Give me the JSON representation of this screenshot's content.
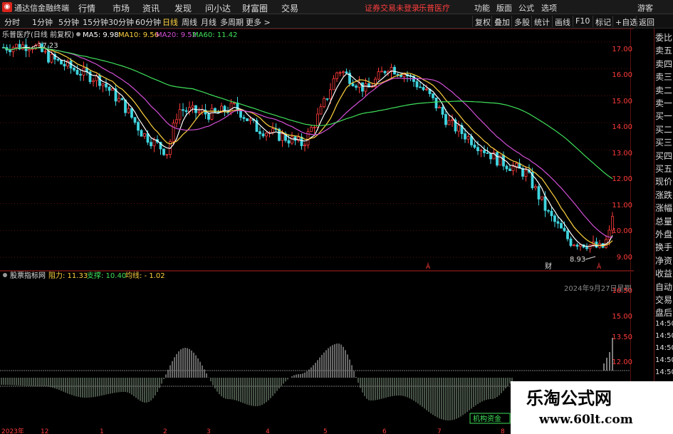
{
  "titlebar": {
    "app_title": "通达信金融终端",
    "menus": [
      "行情",
      "市场",
      "资讯",
      "发现",
      "问小达",
      "财富圈",
      "交易"
    ],
    "alert": "证券交易未登录",
    "stock_name": "乐普医疗",
    "right_menus": [
      "功能",
      "版面",
      "公式",
      "选项"
    ],
    "user": "游客"
  },
  "periods": [
    "分时",
    "1分钟",
    "5分钟",
    "15分钟",
    "30分钟",
    "60分钟",
    "日线",
    "周线",
    "月线",
    "多周期",
    "更多 >"
  ],
  "active_period": "日线",
  "toolbar": [
    "复权",
    "叠加",
    "多股",
    "统计",
    "画线",
    "F10",
    "标记",
    "+自选",
    "返回"
  ],
  "main_legend": {
    "title": "乐普医疗(日线 前复权)",
    "ma5": "MA5: 9.98",
    "ma10": "MA10: 9.56",
    "ma20": "MA20: 9.52",
    "ma60": "MA60: 11.42"
  },
  "price_ticks": [
    "17.00",
    "16.00",
    "15.00",
    "14.00",
    "13.00",
    "12.00",
    "11.00",
    "10.00",
    "9.00"
  ],
  "annotations": {
    "high": "17.23",
    "low": "8.93",
    "fin": "财"
  },
  "indicator": {
    "name": "股票指标网",
    "resist_label": "阻力: 11.33",
    "support_label": "支撑: 10.40",
    "avgline_label": "均线: -  1.02",
    "date_note": "2024年9月27日星期",
    "ticks": [
      "16.50",
      "15.00",
      "13.50",
      "12.00"
    ],
    "badge": "机构资金"
  },
  "xaxis": {
    "labels": [
      "2023年",
      "12",
      "1",
      "2",
      "3",
      "4",
      "5",
      "6",
      "7",
      "8"
    ]
  },
  "side_panel": {
    "items": [
      "委比",
      "卖五",
      "卖四",
      "卖三",
      "卖二",
      "卖一",
      "买一",
      "买二",
      "买三",
      "买四",
      "买五",
      "现价",
      "涨跌",
      "涨幅",
      "总量",
      "外盘",
      "换手",
      "净资",
      "收益",
      "自动",
      "交易",
      "盘后",
      "14:50",
      "14:50",
      "14:50",
      "14:50",
      "14:50",
      "14:50",
      "14:50"
    ]
  },
  "watermark": {
    "line1": "乐淘公式网",
    "line2": "www.60lt.com"
  },
  "colors": {
    "up": "#ff3b3b",
    "down": "#3fd5e0",
    "ma5": "#ffffff",
    "ma10": "#ffd23f",
    "ma20": "#d24fd6",
    "ma60": "#3fe05a",
    "grid": "#5a1010"
  },
  "chart_data": {
    "type": "candlestick",
    "series": [
      {
        "name": "MA5",
        "value": 9.98
      },
      {
        "name": "MA10",
        "value": 9.56
      },
      {
        "name": "MA20",
        "value": 9.52
      },
      {
        "name": "MA60",
        "value": 11.42
      }
    ],
    "ylim": [
      8.5,
      17.5
    ],
    "high": 17.23,
    "low": 8.93
  }
}
